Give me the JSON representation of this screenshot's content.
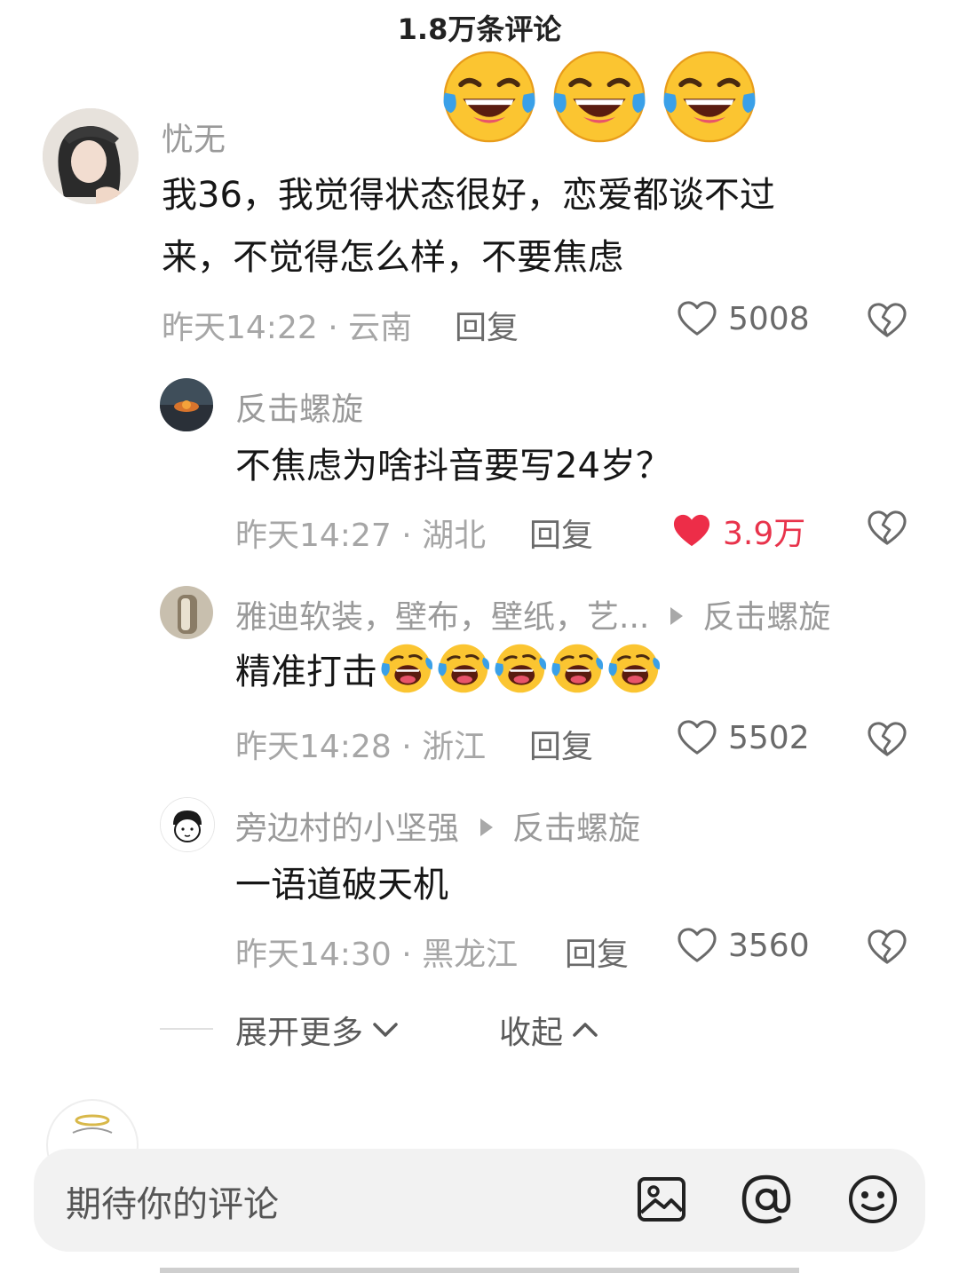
{
  "header": {
    "title": "1.8万条评论"
  },
  "comments": [
    {
      "username": "忧无",
      "text_line1": "我36，我觉得状态很好，恋爱都谈不过",
      "text_line2": "来，不觉得怎么样，不要焦虑",
      "meta": "昨天14:22 · 云南",
      "reply_label": "回复",
      "likes": "5008",
      "liked": false
    },
    {
      "username": "反击螺旋",
      "text": "不焦虑为啥抖音要写24岁？",
      "meta": "昨天14:27 · 湖北",
      "reply_label": "回复",
      "likes": "3.9万",
      "liked": true
    },
    {
      "username": "雅迪软装，壁布，壁纸，艺...",
      "reply_to": "反击螺旋",
      "text": "精准打击",
      "emoji_count": 5,
      "meta": "昨天14:28 · 浙江",
      "reply_label": "回复",
      "likes": "5502",
      "liked": false
    },
    {
      "username": "旁边村的小坚强",
      "reply_to": "反击螺旋",
      "text": "一语道破天机",
      "meta": "昨天14:30 · 黑龙江",
      "reply_label": "回复",
      "likes": "3560",
      "liked": false
    }
  ],
  "expand": {
    "more_label": "展开更多",
    "collapse_label": "收起"
  },
  "input": {
    "placeholder": "期待你的评论"
  },
  "icons": [
    "laughing-crying-emoji-icon",
    "heart-icon",
    "broken-heart-icon",
    "image-icon",
    "at-icon",
    "smiley-icon",
    "chevron-down-icon",
    "chevron-up-icon"
  ],
  "colors": {
    "liked": "#e8334b",
    "secondary_text": "#9a9a9a",
    "input_bg": "#f2f2f2"
  }
}
